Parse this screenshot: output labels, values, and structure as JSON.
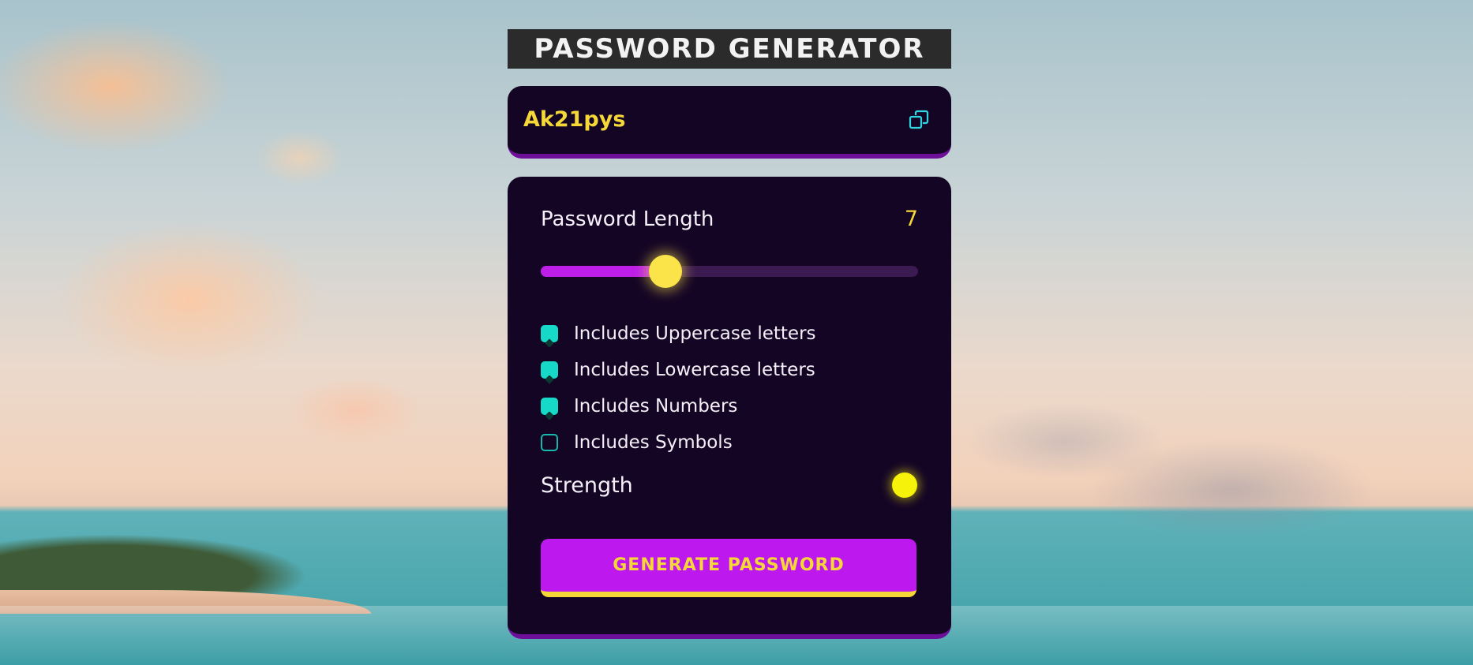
{
  "app": {
    "title": "PASSWORD GENERATOR"
  },
  "output": {
    "password": "Ak21pys",
    "copy_icon": "copy-icon"
  },
  "settings": {
    "length_label": "Password Length",
    "length_value": "7",
    "length_slider_fraction": 0.33,
    "options": [
      {
        "label": "Includes Uppercase letters",
        "checked": true
      },
      {
        "label": "Includes Lowercase letters",
        "checked": true
      },
      {
        "label": "Includes Numbers",
        "checked": true
      },
      {
        "label": "Includes Symbols",
        "checked": false
      }
    ],
    "strength_label": "Strength",
    "strength_color": "#f7f20a",
    "generate_label": "GENERATE PASSWORD"
  },
  "colors": {
    "panel_bg": "#150525",
    "accent_purple": "#bd18ee",
    "accent_yellow": "#f5d838",
    "checkbox_teal": "#17d9c7"
  }
}
